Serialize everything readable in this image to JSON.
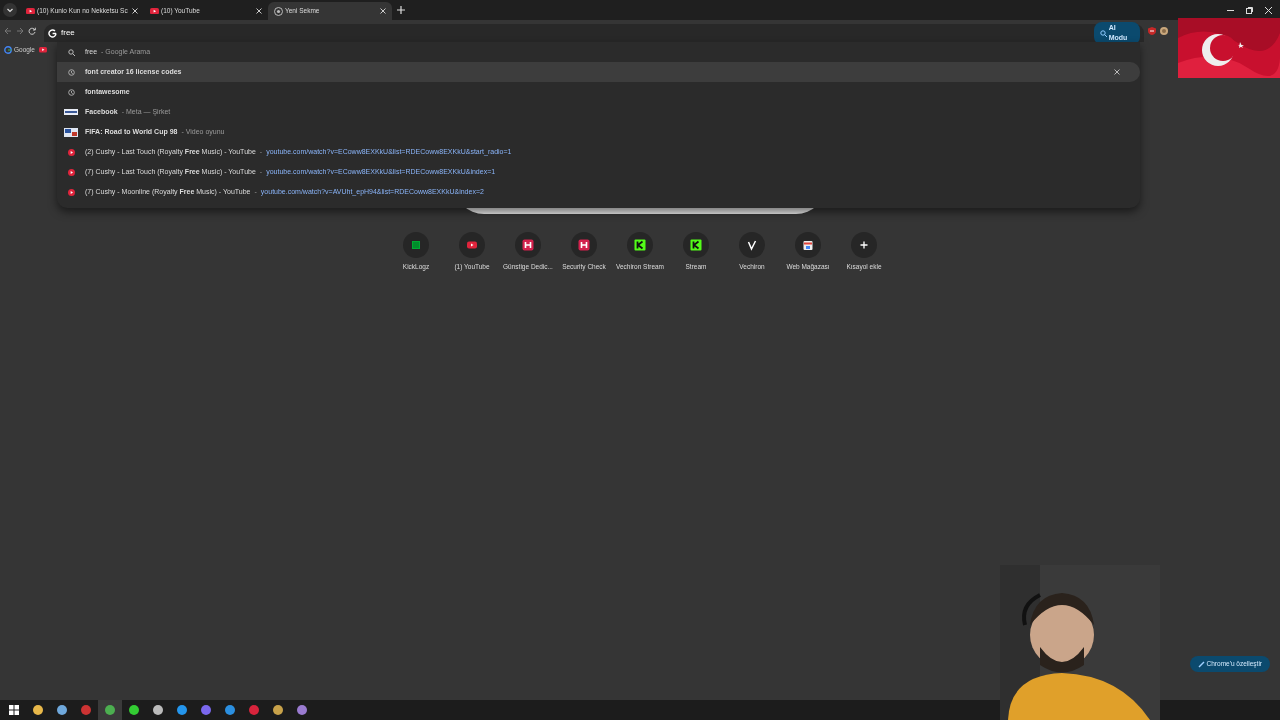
{
  "tabs": [
    {
      "title": "(10) Kunio Kun no Nekketsu Sc",
      "kind": "youtube",
      "selected": false
    },
    {
      "title": "(10) YouTube",
      "kind": "youtube",
      "selected": false
    },
    {
      "title": "Yeni Sekme",
      "kind": "chrome",
      "selected": true
    }
  ],
  "address": {
    "value": "free"
  },
  "ai_mode": {
    "label": "AI Modu"
  },
  "bookmarks": [
    {
      "kind": "google",
      "label": "Google"
    },
    {
      "kind": "youtube"
    }
  ],
  "suggestions": [
    {
      "kind": "search",
      "title": "free",
      "detail": "- Google Arama",
      "selected": false
    },
    {
      "kind": "history",
      "title": "font creator 16 license codes",
      "selected": true
    },
    {
      "kind": "history",
      "title": "fontawesome",
      "selected": false
    },
    {
      "kind": "site",
      "title": "Facebook",
      "detail": "- Meta — Şirket",
      "selected": false
    },
    {
      "kind": "game",
      "title": "FIFA: Road to World Cup 98",
      "detail": "- Video oyunu",
      "selected": false
    },
    {
      "kind": "youtube",
      "title": "(2) Cushy - Last Touch (Royalty **Free** Music) - YouTube",
      "separator": "-",
      "url": "youtube.com/watch?v=ECoww8EXKkU&list=RDECoww8EXKkU&start_radio=1",
      "selected": false
    },
    {
      "kind": "youtube",
      "title": "(7) Cushy - Last Touch (Royalty **Free** Music) - YouTube",
      "separator": "-",
      "url": "youtube.com/watch?v=ECoww8EXKkU&list=RDECoww8EXKkU&index=1",
      "selected": false
    },
    {
      "kind": "youtube",
      "title": "(7) Cushy - Moonline (Royalty **Free** Music) - YouTube",
      "separator": "-",
      "url": "youtube.com/watch?v=AVUht_epH94&list=RDECoww8EXKkU&index=2",
      "selected": false
    }
  ],
  "shortcuts": [
    {
      "kind": "kicklogz",
      "label": "KickLogz"
    },
    {
      "kind": "youtube",
      "label": "(1) YouTube"
    },
    {
      "kind": "h",
      "label": "Günstige Dedic..."
    },
    {
      "kind": "h",
      "label": "Security Check"
    },
    {
      "kind": "k",
      "label": "Vechiron Stream"
    },
    {
      "kind": "k",
      "label": "Stream"
    },
    {
      "kind": "v",
      "label": "Vechiron"
    },
    {
      "kind": "store",
      "label": "Web Mağazası"
    },
    {
      "kind": "add",
      "label": "Kısayol ekle"
    }
  ],
  "customize": {
    "label": "Chrome'u özelleştir"
  },
  "taskbar": [
    {
      "color": "#ffffff",
      "selected": false
    },
    {
      "color": "#e8b84a",
      "selected": false
    },
    {
      "color": "#6fa8dc",
      "selected": false
    },
    {
      "color": "#cc3333",
      "selected": false
    },
    {
      "color": "#4caf50",
      "selected": true
    },
    {
      "color": "#33cc33",
      "selected": false
    },
    {
      "color": "#bbbbbb",
      "selected": false
    },
    {
      "color": "#2496ed",
      "selected": false
    },
    {
      "color": "#7b68ee",
      "selected": false
    },
    {
      "color": "#2b8fe0",
      "selected": false
    },
    {
      "color": "#d8243c",
      "selected": false
    },
    {
      "color": "#c8a24a",
      "selected": false
    },
    {
      "color": "#9a7bd0",
      "selected": false
    }
  ]
}
